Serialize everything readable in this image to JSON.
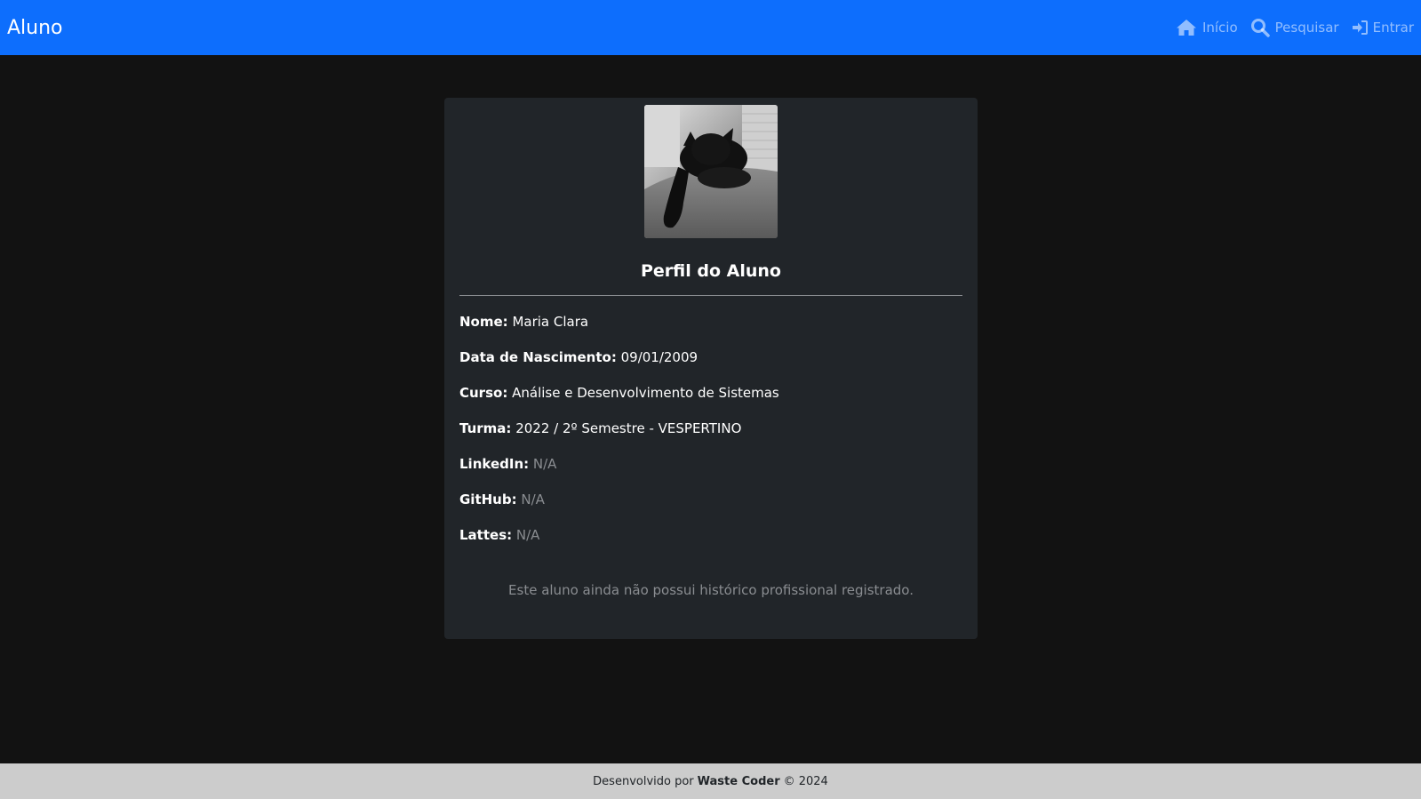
{
  "navbar": {
    "brand": "Aluno",
    "links": [
      {
        "label": "Início",
        "icon": "home-icon"
      },
      {
        "label": "Pesquisar",
        "icon": "search-icon"
      },
      {
        "label": "Entrar",
        "icon": "sign-in-icon"
      }
    ],
    "color": "#0d6efd"
  },
  "profile": {
    "title": "Perfil do Aluno",
    "fields": [
      {
        "label": "Nome:",
        "value": "Maria Clara"
      },
      {
        "label": "Data de Nascimento:",
        "value": "09/01/2009"
      },
      {
        "label": "Curso:",
        "value": "Análise e Desenvolvimento de Sistemas"
      },
      {
        "label": "Turma:",
        "value": "2022 / 2º Semestre - VESPERTINO"
      },
      {
        "label": "LinkedIn:",
        "value": "N/A"
      },
      {
        "label": "GitHub:",
        "value": "N/A"
      },
      {
        "label": "Lattes:",
        "value": "N/A"
      }
    ],
    "empty_history": "Este aluno ainda não possui histórico profissional registrado."
  },
  "footer": {
    "prefix": "Desenvolvido por",
    "author": "Waste Coder",
    "suffix": "© 2024"
  }
}
